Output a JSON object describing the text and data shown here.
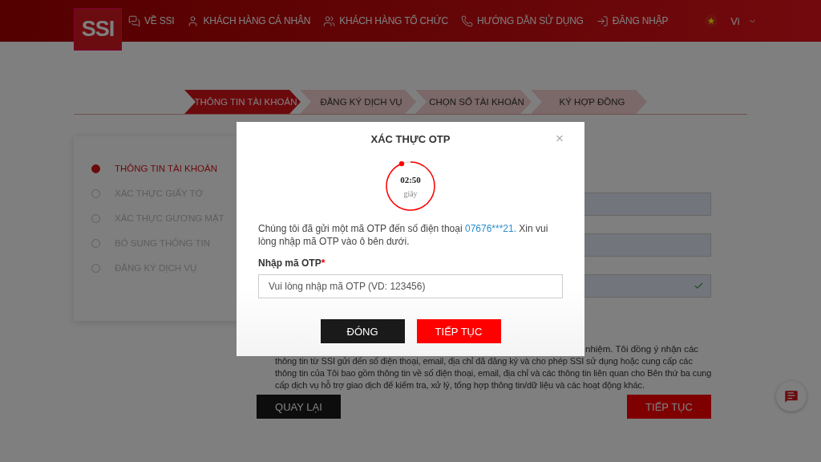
{
  "header": {
    "logo": "SSI",
    "nav": [
      {
        "label": "VỀ SSI",
        "kind": "about"
      },
      {
        "label": "KHÁCH HÀNG CÁ NHÂN",
        "kind": "person"
      },
      {
        "label": "KHÁCH HÀNG TỔ CHỨC",
        "kind": "group"
      },
      {
        "label": "HƯỚNG DẪN SỬ DỤNG",
        "kind": "phone"
      },
      {
        "label": "ĐĂNG NHẬP",
        "kind": "login"
      }
    ],
    "language": "Vi"
  },
  "stepper": [
    {
      "label": "THÔNG TIN TÀI KHOẢN",
      "selected": true
    },
    {
      "label": "ĐĂNG KÝ DỊCH VỤ",
      "selected": false
    },
    {
      "label": "CHỌN SỐ TÀI KHOẢN",
      "selected": false
    },
    {
      "label": "KÝ HỢP ĐỒNG",
      "selected": false
    }
  ],
  "sidebar": [
    {
      "label": "THÔNG TIN TÀI KHOẢN",
      "selected": true
    },
    {
      "label": "XÁC THỰC GIẤY TỜ",
      "selected": false
    },
    {
      "label": "XÁC THỰC GƯƠNG MẶT",
      "selected": false
    },
    {
      "label": "BỔ SUNG THÔNG TIN",
      "selected": false
    },
    {
      "label": "ĐĂNG KÝ DỊCH VỤ",
      "selected": false
    }
  ],
  "form": {
    "fields": [
      {
        "valid": false
      },
      {
        "valid": false
      },
      {
        "valid": true
      }
    ],
    "consent_fragment": "nhiệm. Tôi đồng ý nhận các",
    "consent_text": "thông tin từ SSI gửi đến số điện thoại, email, địa chỉ đã đăng ký và cho phép SSI sử dụng hoặc cung cấp các thông tin của Tôi bao gồm thông tin về số điện thoại, email, địa chỉ và các thông tin liên quan cho Bên thứ ba cung cấp dịch vụ hỗ trợ giao dịch để kiểm tra, xử lý, tổng hợp thông tin/dữ liệu và các hoạt động khác.",
    "back_button": "QUAY LẠI",
    "next_button": "TIẾP TỤC"
  },
  "modal": {
    "title": "XÁC THỰC OTP",
    "close": "×",
    "timer": {
      "time": "02:50",
      "unit": "giây"
    },
    "message_before": "Chúng tôi đã gửi một mã OTP đến số điện thoại ",
    "phone": "07676***21.",
    "message_after": " Xin vui lòng nhập mã OTP vào ô bên dưới.",
    "otp_label": "Nhập mã OTP",
    "required_mark": "*",
    "otp_placeholder": "Vui lòng nhập mã OTP (VD: 123456)",
    "close_button": "ĐÓNG",
    "continue_button": "TIẾP TỤC"
  }
}
